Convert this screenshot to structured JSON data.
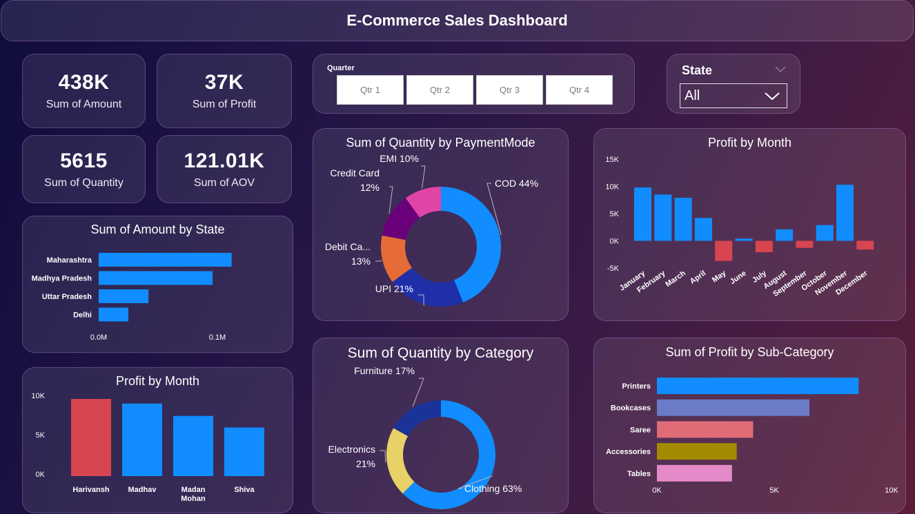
{
  "header": {
    "title": "E-Commerce Sales Dashboard"
  },
  "kpis": [
    {
      "value": "438K",
      "label": "Sum of Amount"
    },
    {
      "value": "37K",
      "label": "Sum of Profit"
    },
    {
      "value": "5615",
      "label": "Sum of Quantity"
    },
    {
      "value": "121.01K",
      "label": "Sum of AOV"
    }
  ],
  "quarter_filter": {
    "title": "Quarter",
    "options": [
      "Qtr 1",
      "Qtr 2",
      "Qtr 3",
      "Qtr 4"
    ]
  },
  "state_filter": {
    "title": "State",
    "selected": "All"
  },
  "chart_data": [
    {
      "id": "amount_by_state",
      "type": "bar",
      "orientation": "horizontal",
      "title": "Sum of Amount by State",
      "categories": [
        "Maharashtra",
        "Madhya Pradesh",
        "Uttar Pradesh",
        "Delhi"
      ],
      "values": [
        0.112,
        0.096,
        0.042,
        0.025
      ],
      "xticks": [
        "0.0M",
        "0.1M"
      ],
      "xlim": [
        0,
        0.1
      ],
      "color": "#118dff"
    },
    {
      "id": "profit_by_person",
      "type": "bar",
      "title": "Profit by Month",
      "categories": [
        "Harivansh",
        "Madhav",
        "Madan Mohan",
        "Shiva"
      ],
      "values": [
        10000,
        9400,
        7800,
        6300
      ],
      "colors": [
        "#d64550",
        "#118dff",
        "#118dff",
        "#118dff"
      ],
      "yticks": [
        "10K",
        "5K",
        "0K"
      ],
      "ylim": [
        0,
        10000
      ]
    },
    {
      "id": "qty_by_payment",
      "type": "pie",
      "donut": true,
      "title": "Sum of Quantity by PaymentMode",
      "slices": [
        {
          "label": "COD 44%",
          "value": 44,
          "color": "#118dff"
        },
        {
          "label": "UPI 21%",
          "value": 21,
          "color": "#1f2fa8"
        },
        {
          "label": "Debit Ca...",
          "label2": "13%",
          "value": 13,
          "color": "#e66c37"
        },
        {
          "label": "Credit Card",
          "label2": "12%",
          "value": 12,
          "color": "#6b007b"
        },
        {
          "label": "EMI 10%",
          "value": 10,
          "color": "#e044a7"
        }
      ]
    },
    {
      "id": "qty_by_category",
      "type": "pie",
      "donut": true,
      "title": "Sum of Quantity by Category",
      "slices": [
        {
          "label": "Clothing 63%",
          "value": 63,
          "color": "#118dff"
        },
        {
          "label": "Electronics",
          "label2": "21%",
          "value": 21,
          "color": "#e8d166"
        },
        {
          "label": "Furniture 17%",
          "value": 17,
          "color": "#1a3399"
        }
      ]
    },
    {
      "id": "profit_by_month",
      "type": "bar",
      "title": "Profit by Month",
      "categories": [
        "January",
        "February",
        "March",
        "April",
        "May",
        "June",
        "July",
        "August",
        "September",
        "October",
        "November",
        "December"
      ],
      "values": [
        9800,
        8500,
        7900,
        4200,
        -3700,
        400,
        -2100,
        2100,
        -1300,
        2900,
        10300,
        -1600
      ],
      "positive_color": "#118dff",
      "negative_color": "#d64550",
      "yticks": [
        "15K",
        "10K",
        "5K",
        "0K",
        "-5K"
      ],
      "ylim": [
        -5000,
        15000
      ]
    },
    {
      "id": "profit_by_subcategory",
      "type": "bar",
      "orientation": "horizontal",
      "title": "Sum of Profit by Sub-Category",
      "categories": [
        "Printers",
        "Bookcases",
        "Saree",
        "Accessories",
        "Tables"
      ],
      "values": [
        8600,
        6500,
        4100,
        3400,
        3200
      ],
      "colors": [
        "#118dff",
        "#6b7bc8",
        "#e06c78",
        "#a38a00",
        "#e58ac8"
      ],
      "xticks": [
        "0K",
        "5K",
        "10K"
      ],
      "xlim": [
        0,
        10000
      ]
    }
  ]
}
